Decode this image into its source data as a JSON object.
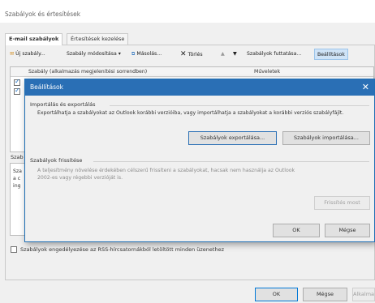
{
  "window": {
    "title": "Szabályok és értesítések"
  },
  "tabs": [
    {
      "label": "E-mail szabályok",
      "active": true
    },
    {
      "label": "Értesítések kezelése",
      "active": false
    }
  ],
  "toolbar": {
    "new_rule": "Új szabály...",
    "change_rule": "Szabály módosítása",
    "change_rule_arrow": "▾",
    "copy": "Másolás...",
    "delete": "Törlés",
    "up": "▲",
    "down": "▼",
    "run_rules": "Szabályok futtatása...",
    "options": "Beállítások"
  },
  "rules_grid": {
    "col_rule": "Szabály (alkalmazás megjelenítési sorrendben)",
    "col_actions": "Műveletek",
    "rows": [
      {
        "checked": true
      },
      {
        "checked": true
      }
    ]
  },
  "description": {
    "label": "Szab",
    "line1": "Sza",
    "line2": "a c",
    "line3": "ing"
  },
  "rss_checkbox": {
    "label": "Szabályok engedélyezése az RSS-hírcsatornákból letöltött minden üzenethez",
    "checked": false
  },
  "footer": {
    "ok": "OK",
    "cancel": "Mégse",
    "apply": "Alkalmaz"
  },
  "modal": {
    "title": "Beállítások",
    "close_glyph": "✕",
    "import_export": {
      "heading": "Importálás és exportálás",
      "text": "Exportálhatja a szabályokat az Outlook korábbi verzióiba, vagy importálhatja a szabályokat a korábbi verziós szabályfájlt.",
      "export_button": "Szabályok exportálása...",
      "import_button": "Szabályok importálása..."
    },
    "update": {
      "heading": "Szabályok frissítése",
      "text_line1": "A teljesítmény növelése érdekében célszerű frissíteni a szabályokat, hacsak nem használja az Outlook",
      "text_line2": "2002-es vagy régebbi verzióját is.",
      "update_button": "Frissítés most"
    },
    "ok": "OK",
    "cancel": "Mégse"
  }
}
